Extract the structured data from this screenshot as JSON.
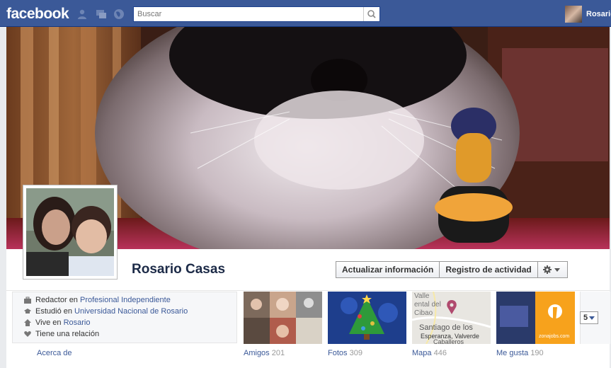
{
  "topbar": {
    "logo": "facebook",
    "search_placeholder": "Buscar",
    "user_name": "Rosario",
    "colors": {
      "bar": "#3b5998",
      "text": "#ffffff"
    }
  },
  "profile": {
    "name": "Rosario Casas",
    "actions": {
      "update_info": "Actualizar información",
      "activity_log": "Registro de actividad"
    },
    "about": [
      {
        "icon": "briefcase-icon",
        "prefix": "Redactor en ",
        "link": "Profesional Independiente"
      },
      {
        "icon": "graduation-cap-icon",
        "prefix": "Estudió en ",
        "link": "Universidad Nacional de Rosario"
      },
      {
        "icon": "house-icon",
        "prefix": "Vive en ",
        "link": "Rosario"
      },
      {
        "icon": "heart-icon",
        "prefix": "Tiene una relación",
        "link": ""
      }
    ],
    "about_label": "Acerca de"
  },
  "tiles": [
    {
      "label": "Amigos",
      "count": "201"
    },
    {
      "label": "Fotos",
      "count": "309"
    },
    {
      "label": "Mapa",
      "count": "446"
    },
    {
      "label": "Me gusta",
      "count": "190"
    }
  ],
  "map_labels": {
    "l1": "Valle",
    "l2": "ental del",
    "l3": "Cibao",
    "l4": "Santiago de los",
    "l5": "Esperanza, Valverde",
    "l6": "Caballeros"
  },
  "likes_logo_text": "zonajobs.com",
  "more_count": "5"
}
